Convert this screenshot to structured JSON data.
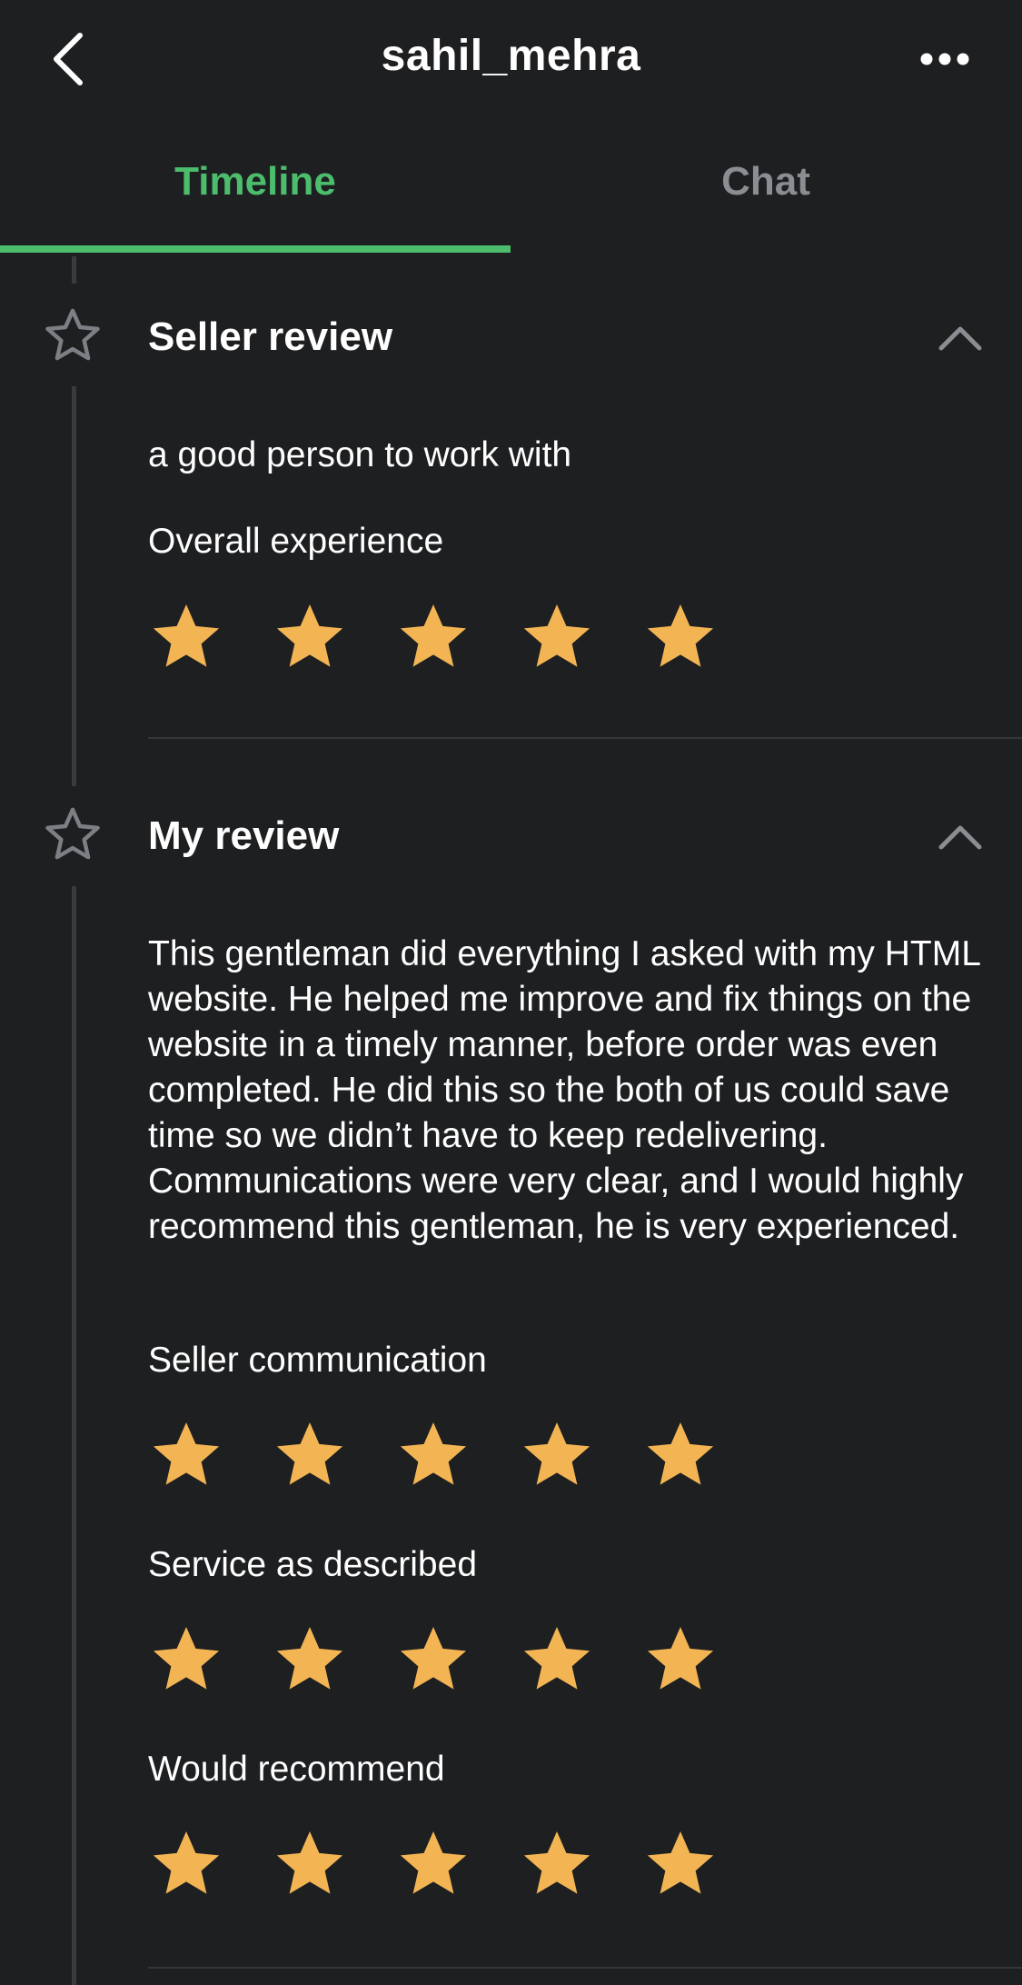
{
  "header": {
    "title": "sahil_mehra"
  },
  "tabs": [
    {
      "label": "Timeline",
      "active": true
    },
    {
      "label": "Chat",
      "active": false
    }
  ],
  "colors": {
    "accent": "#4cbd6c",
    "star": "#f3b553",
    "background": "#1e1f21"
  },
  "seller_review": {
    "title": "Seller review",
    "comment": "a good person to work with",
    "ratings": [
      {
        "label": "Overall experience",
        "stars": 5,
        "max": 5
      }
    ]
  },
  "my_review": {
    "title": "My review",
    "comment": "This gentleman did everything I asked with my HTML website. He helped me improve and fix things on the website in a timely manner, before order was even completed. He did this so the both of us could save time so we didn’t have to keep redelivering. Communications were very clear, and I would highly recommend this gentleman, he is very experienced.",
    "ratings": [
      {
        "label": "Seller communication",
        "stars": 5,
        "max": 5
      },
      {
        "label": "Service as described",
        "stars": 5,
        "max": 5
      },
      {
        "label": "Would recommend",
        "stars": 5,
        "max": 5
      }
    ]
  }
}
